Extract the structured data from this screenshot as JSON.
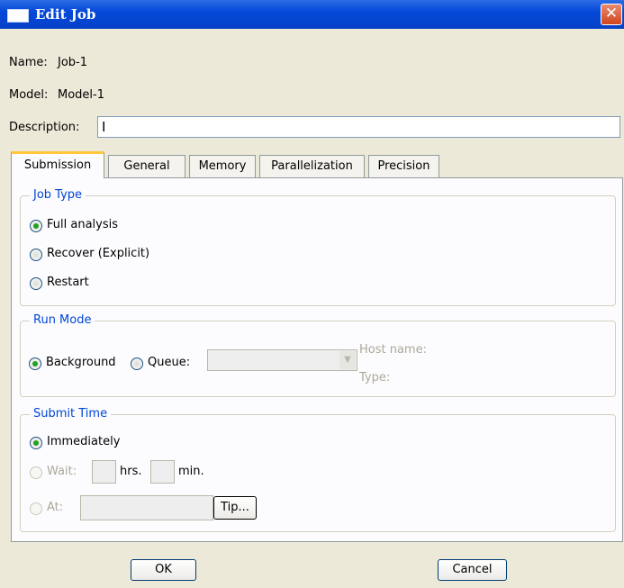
{
  "window": {
    "title": "Edit Job",
    "close_glyph": "✕"
  },
  "fields": {
    "name_label": "Name:",
    "name_value": "Job-1",
    "model_label": "Model:",
    "model_value": "Model-1",
    "description_label": "Description:",
    "description_value": ""
  },
  "tabs": [
    "Submission",
    "General",
    "Memory",
    "Parallelization",
    "Precision"
  ],
  "active_tab": "Submission",
  "job_type": {
    "title": "Job Type",
    "options": [
      "Full analysis",
      "Recover (Explicit)",
      "Restart"
    ],
    "selected": "Full analysis"
  },
  "run_mode": {
    "title": "Run Mode",
    "background_label": "Background",
    "queue_label": "Queue:",
    "queue_value": "",
    "host_name_label": "Host name:",
    "type_label": "Type:",
    "selected": "Background"
  },
  "submit_time": {
    "title": "Submit Time",
    "immediately_label": "Immediately",
    "wait_label": "Wait:",
    "hrs_label": "hrs.",
    "min_label": "min.",
    "at_label": "At:",
    "tip_label": "Tip...",
    "selected": "Immediately"
  },
  "buttons": {
    "ok": "OK",
    "cancel": "Cancel"
  },
  "colors": {
    "titlebar": "#0548d8",
    "group_title": "#0046d5",
    "radio_dot": "#21a121",
    "tab_highlight": "#ffc83c"
  }
}
